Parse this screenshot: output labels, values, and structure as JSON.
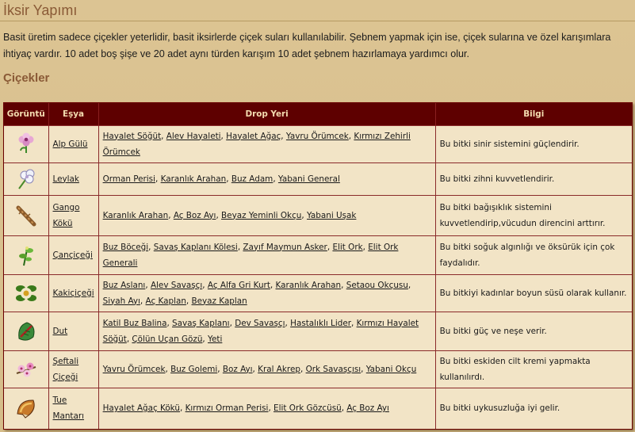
{
  "page": {
    "title": "İksir Yapımı",
    "intro": "Basit üretim sadece çiçekler yeterlidir, basit iksirlerde çiçek suları kullanılabilir. Şebnem yapmak için ise, çiçek sularına ve özel karışımlara ihtiyaç vardır. 10 adet boş şişe ve 20 adet aynı türden karışım 10 adet şebnem hazırlamaya yardımcı olur.",
    "section_heading": "Çiçekler"
  },
  "table": {
    "headers": {
      "image": "Görüntü",
      "item": "Eşya",
      "drop": "Drop Yeri",
      "info": "Bilgi"
    },
    "rows": [
      {
        "icon": "alp-gulu-flower-icon",
        "item": "Alp Gülü",
        "drops": [
          "Hayalet Söğüt",
          "Alev Hayaleti",
          "Hayalet Ağaç",
          "Yavru Örümcek",
          "Kırmızı Zehirli Örümcek"
        ],
        "info": "Bu bitki sinir sistemini güçlendirir."
      },
      {
        "icon": "leylak-flower-icon",
        "item": "Leylak",
        "drops": [
          "Orman Perisi",
          "Karanlık Arahan",
          "Buz Adam",
          "Yabani General"
        ],
        "info": "Bu bitki zihni kuvvetlendirir."
      },
      {
        "icon": "gango-koku-root-icon",
        "item": "Gango Kökü",
        "drops": [
          "Karanlık Arahan",
          "Aç Boz Ayı",
          "Beyaz Yeminli Okçu",
          "Yabani Uşak"
        ],
        "info": "Bu bitki bağışıklık sistemini kuvvetlendirip,vücudun direncini arttırır."
      },
      {
        "icon": "cancicegi-flower-icon",
        "item": "Çançiçeği",
        "drops": [
          "Buz Böceği",
          "Savaş Kaplanı Kölesi",
          "Zayıf Maymun Asker",
          "Elit Ork",
          "Elit Ork Generali"
        ],
        "info": "Bu bitki soğuk algınlığı ve öksürük için çok faydalıdır."
      },
      {
        "icon": "kakicicegi-flower-icon",
        "item": "Kakiçiçeği",
        "drops": [
          "Buz Aslanı",
          "Alev Savaşçı",
          "Aç Alfa Gri Kurt",
          "Karanlık Arahan",
          "Setaou Okçusu",
          "Siyah Ayı",
          "Aç Kaplan",
          "Beyaz Kaplan"
        ],
        "info": "Bu bitkiyi kadınlar boyun süsü olarak kullanır."
      },
      {
        "icon": "dut-leaf-icon",
        "item": "Dut",
        "drops": [
          "Katil Buz Balina",
          "Savaş Kaplanı",
          "Dev Savaşçı",
          "Hastalıklı Lider",
          "Kırmızı Hayalet Söğüt",
          "Çölün Uçan Gözü",
          "Yeti"
        ],
        "info": "Bu bitki güç ve neşe verir."
      },
      {
        "icon": "seftali-cicegi-flower-icon",
        "item": "Şeftali Çiçeği",
        "drops": [
          "Yavru Örümcek",
          "Buz Golemi",
          "Boz Ayı",
          "Kral Akrep",
          "Ork Savaşçısı",
          "Yabani Okçu"
        ],
        "info": "Bu bitki eskiden cilt kremi yapmakta kullanılırdı."
      },
      {
        "icon": "tue-mantari-mushroom-icon",
        "item": "Tue Mantarı",
        "drops": [
          "Hayalet Ağaç Kökü",
          "Kırmızı Orman Perisi",
          "Elit Ork Gözcüsü",
          "Aç Boz Ayı"
        ],
        "info": "Bu bitki uykusuzluğa iyi gelir."
      }
    ]
  }
}
